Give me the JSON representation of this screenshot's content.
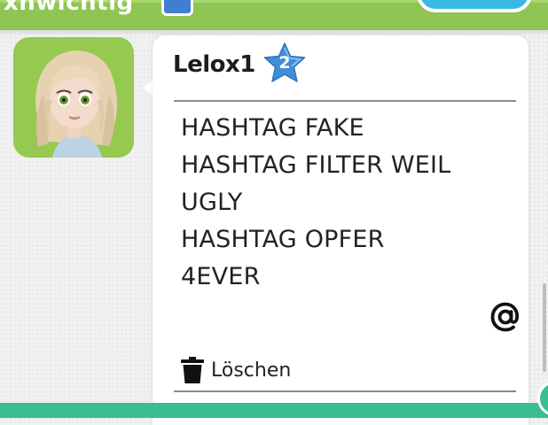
{
  "header": {
    "title": "xnwichtig"
  },
  "post": {
    "username": "Lelox1",
    "level": "2",
    "lines": [
      "HASHTAG FAKE",
      "HASHTAG FILTER WEIL",
      "UGLY",
      "HASHTAG OPFER",
      "4EVER"
    ],
    "mention_symbol": "@",
    "delete_label": "Löschen"
  },
  "icons": {
    "level": "star-badge-icon",
    "mention": "at-sign-icon",
    "delete": "trash-icon"
  },
  "colors": {
    "header_green": "#8fc552",
    "avatar_bg": "#95c94f",
    "level_star": "#3f8fd8",
    "bottom_teal": "#39bd93"
  }
}
